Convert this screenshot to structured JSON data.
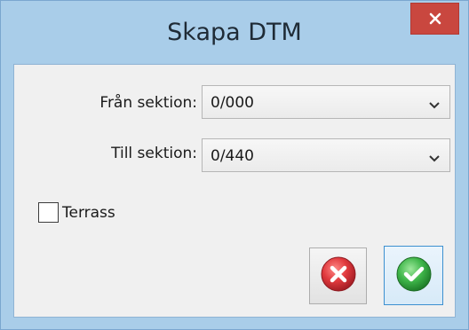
{
  "window": {
    "title": "Skapa DTM"
  },
  "form": {
    "from_label": "Från sektion:",
    "from_value": "0/000",
    "to_label": "Till sektion:",
    "to_value": "0/440",
    "terrace_label": "Terrass",
    "terrace_checked": false
  },
  "icons": {
    "close": "close-icon",
    "cancel": "cancel-icon",
    "ok": "ok-check-icon",
    "dropdown": "chevron-down-icon"
  },
  "colors": {
    "frame": "#a9cde9",
    "close_button": "#c9473f",
    "cancel_red": "#d8393c",
    "ok_green": "#3fb64a"
  }
}
